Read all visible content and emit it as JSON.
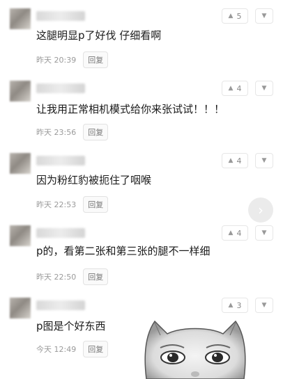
{
  "comments": [
    {
      "text": "这腿明显p了好伐 仔细看啊",
      "time": "昨天 20:39",
      "reply": "回复",
      "votes": "5"
    },
    {
      "text": "让我用正常相机模式给你来张试试！！！",
      "time": "昨天 23:56",
      "reply": "回复",
      "votes": "4"
    },
    {
      "text": "因为粉红豹被扼住了咽喉",
      "time": "昨天 22:53",
      "reply": "回复",
      "votes": "4"
    },
    {
      "text": "p的，看第二张和第三张的腿不一样细",
      "time": "昨天 22:50",
      "reply": "回复",
      "votes": "4"
    },
    {
      "text": "p图是个好东西",
      "time": "今天 12:49",
      "reply": "回复",
      "votes": "3"
    }
  ],
  "icons": {
    "upvote": "caret-up-icon",
    "downvote": "caret-down-icon",
    "next": "chevron-right-icon"
  }
}
